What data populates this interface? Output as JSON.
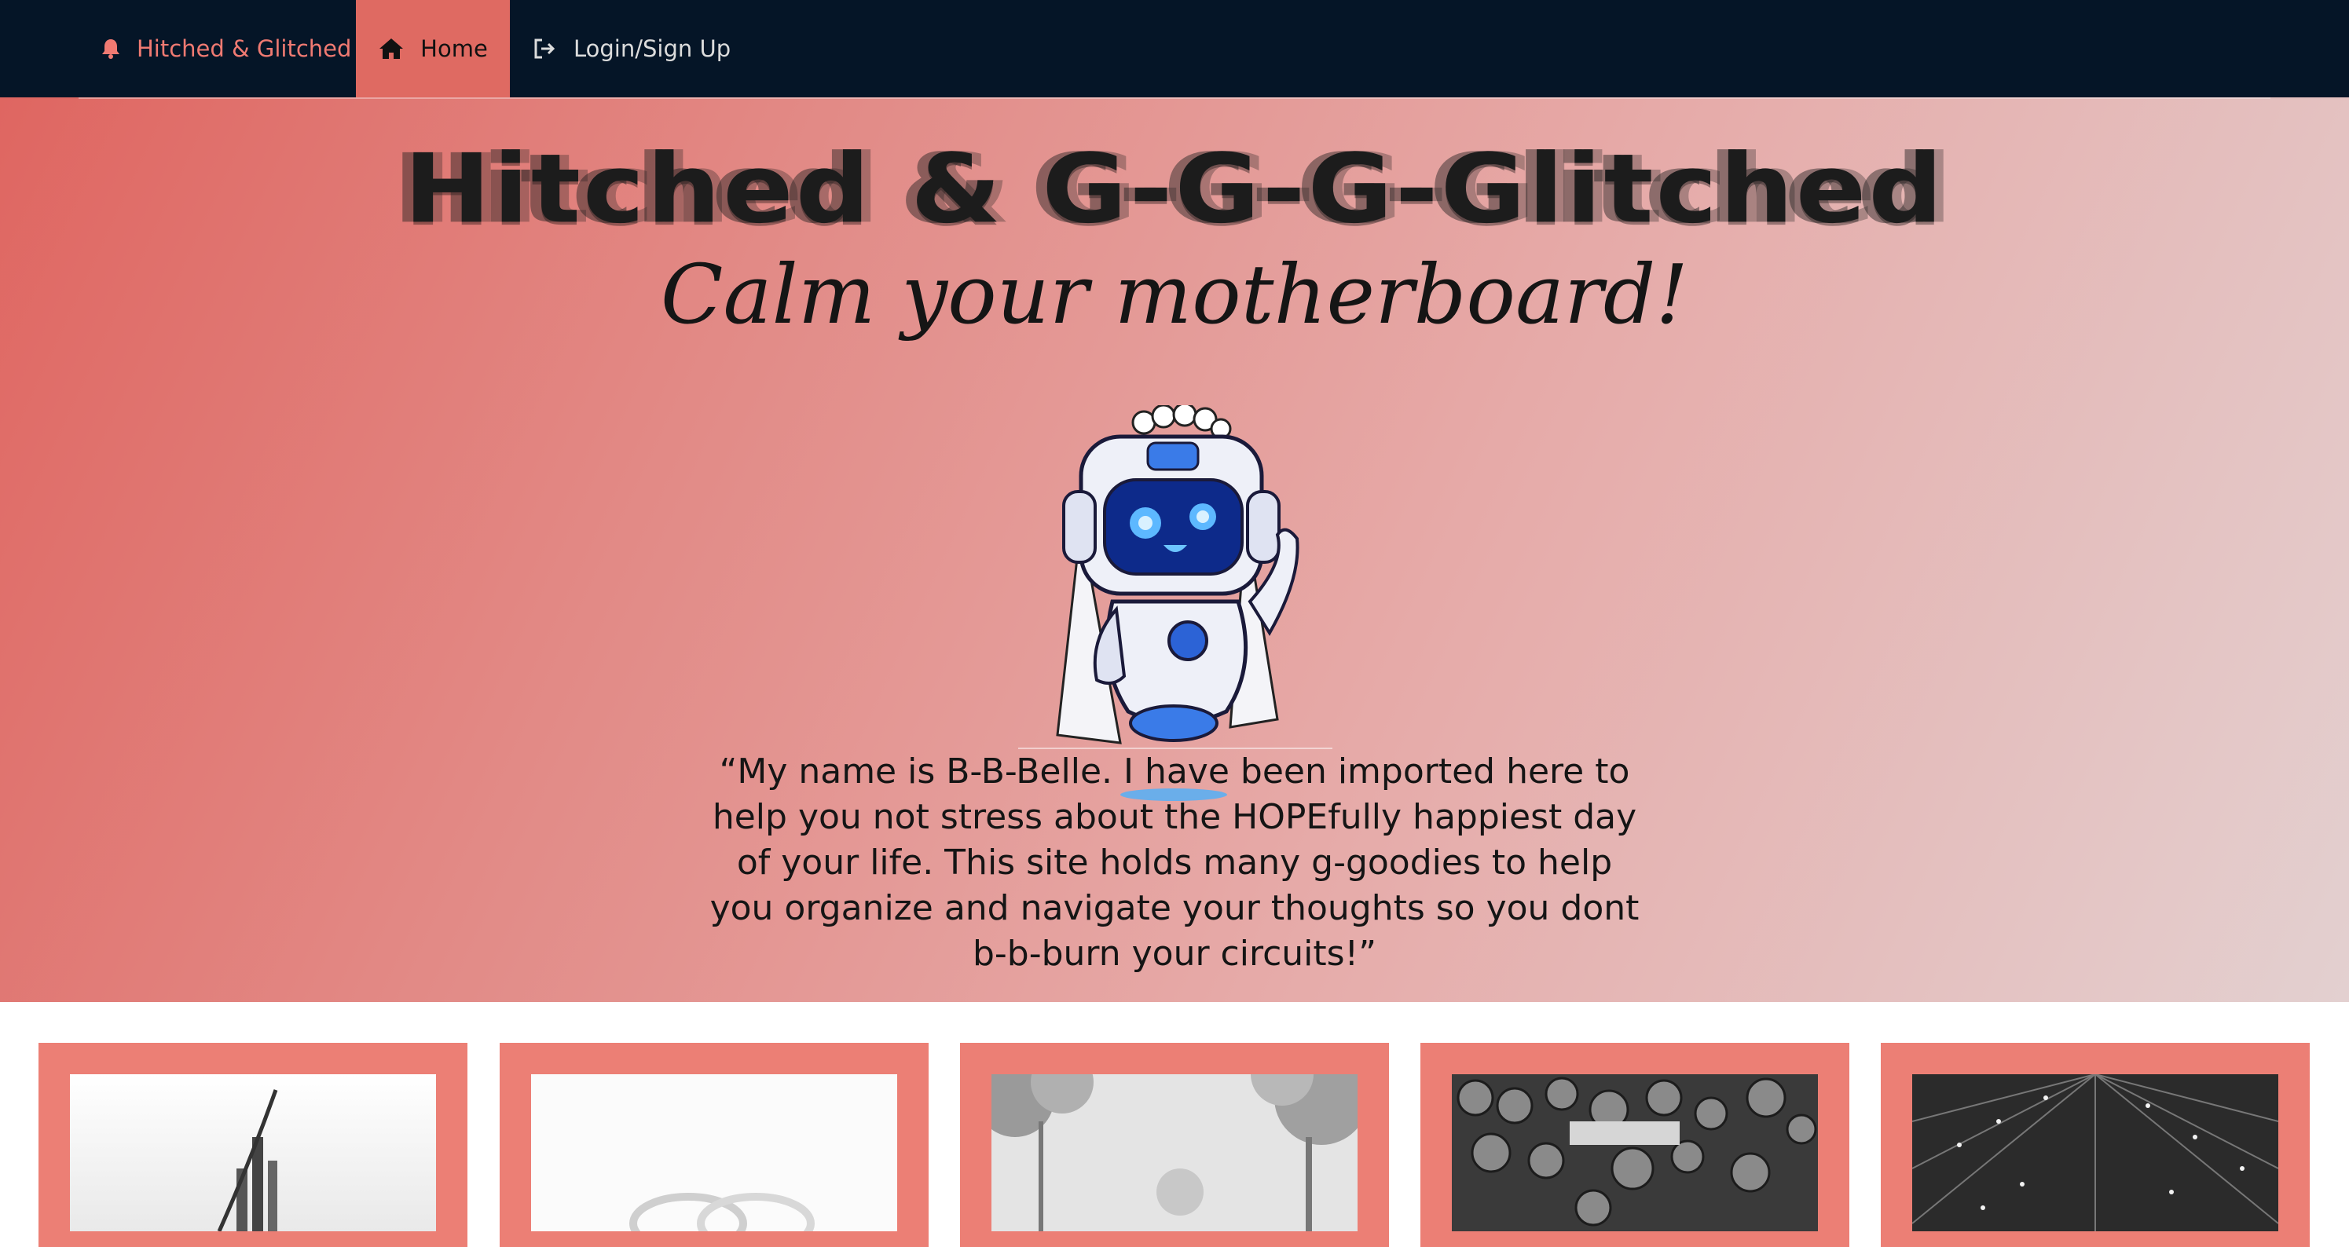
{
  "nav": {
    "brand": {
      "label": "Hitched & Glitched",
      "icon": "bell-icon"
    },
    "home": {
      "label": "Home",
      "icon": "home-icon"
    },
    "login": {
      "label": "Login/Sign Up",
      "icon": "sign-in-icon"
    }
  },
  "hero": {
    "title": "Hitched & G-G-G-Glitched",
    "tagline": "Calm your motherboard!",
    "quote": "“My name is B-B-Belle. I have been imported here to help you not stress about the HOPEfully happiest day of your life. This site holds many g-goodies to help you organize and navigate your thoughts so you dont b-b-burn your circuits!”"
  },
  "cards": [
    {
      "image": "bar-chart-sketch"
    },
    {
      "image": "wedding-rings"
    },
    {
      "image": "trees"
    },
    {
      "image": "food-platters"
    },
    {
      "image": "string-lights"
    }
  ],
  "colors": {
    "nav_bg": "#051527",
    "accent": "#df6a62",
    "brand_text": "#f07a72",
    "card_bg": "#ec7f75"
  }
}
